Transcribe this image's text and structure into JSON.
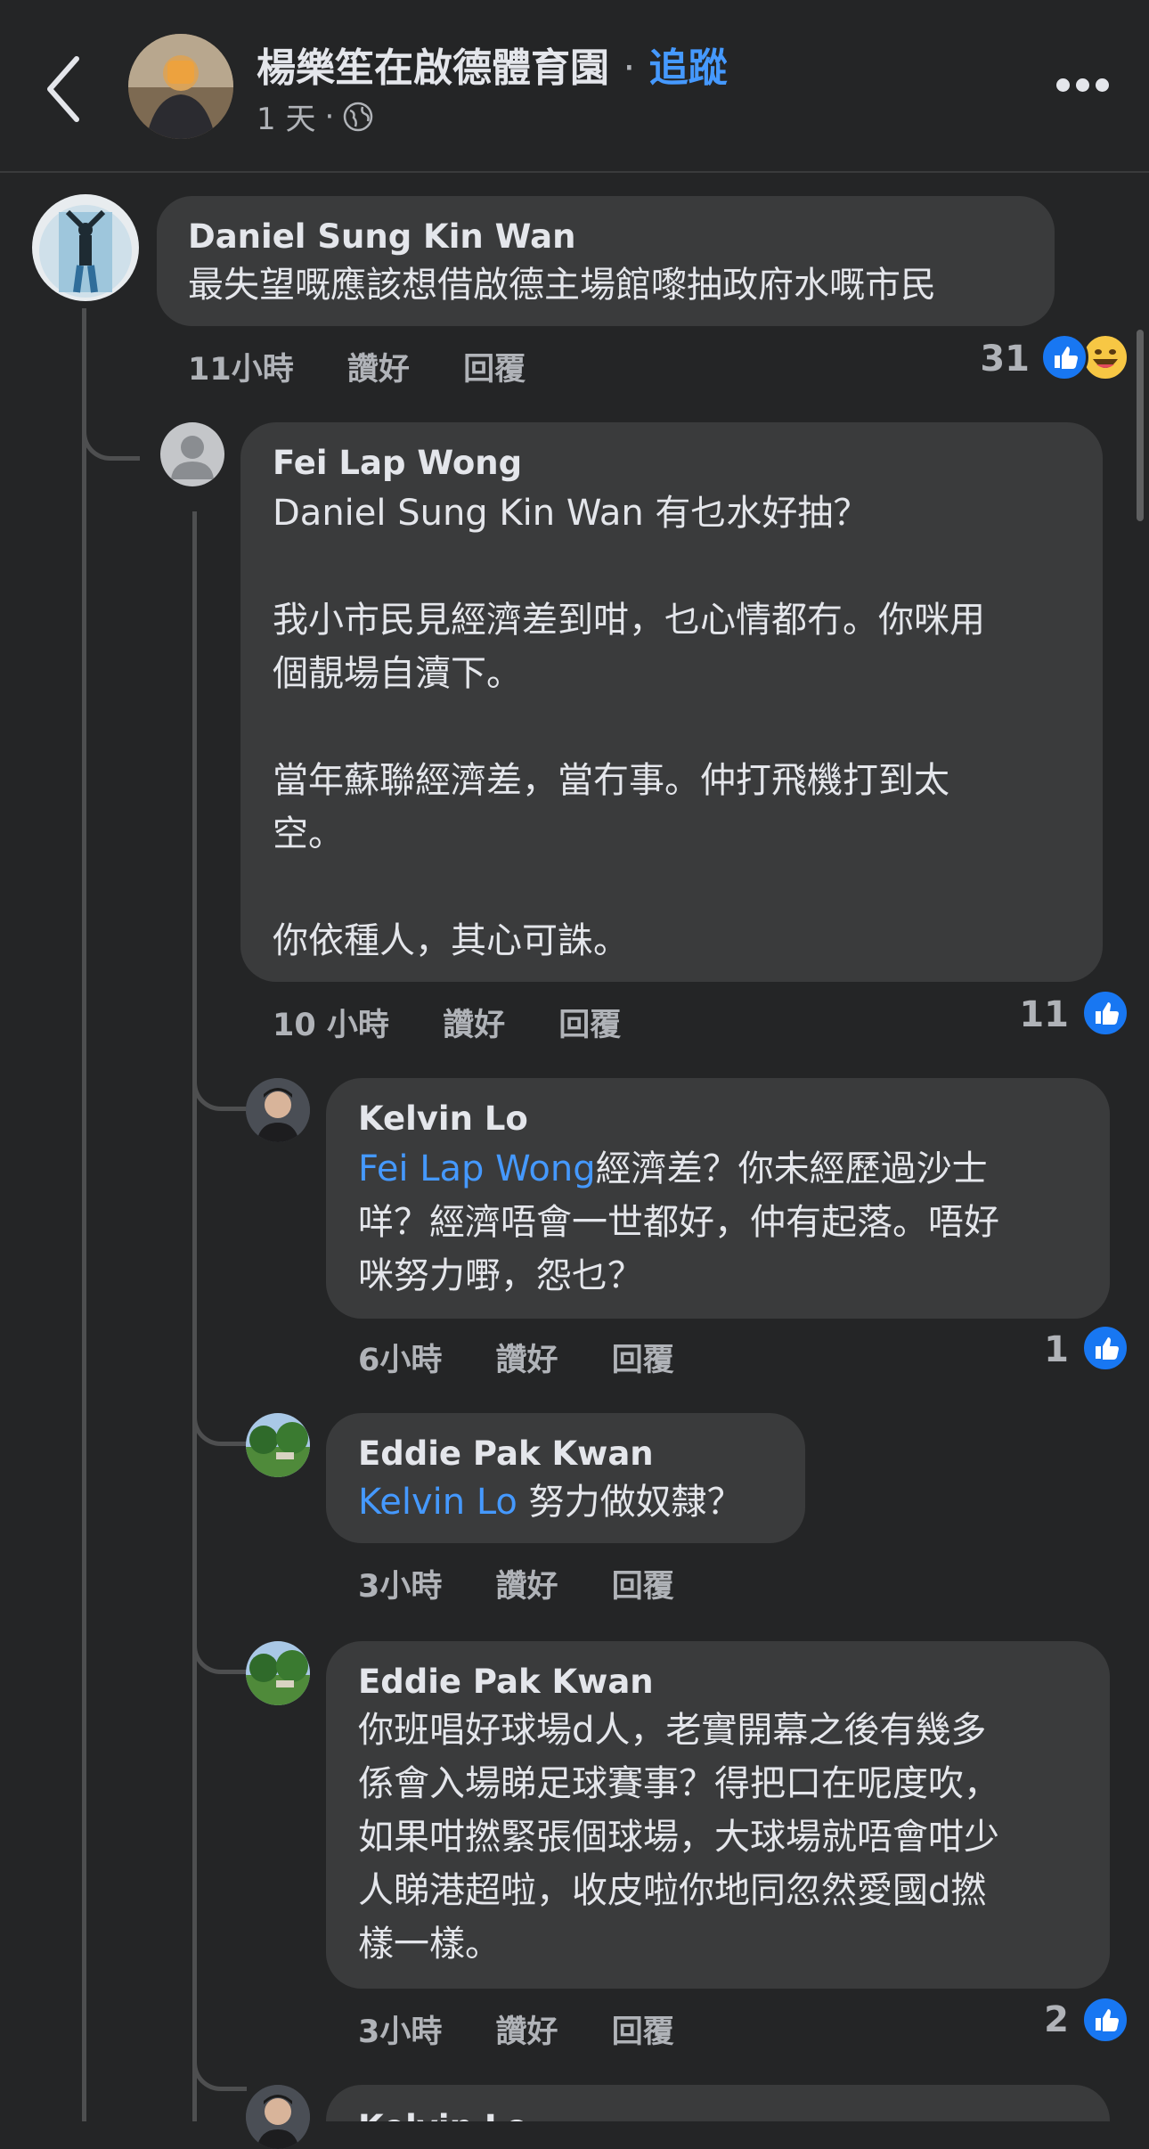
{
  "header": {
    "title": "楊樂笙在啟德體育園",
    "separator": "·",
    "follow_label": "追蹤",
    "time": "1 天",
    "dot": "·"
  },
  "comments": [
    {
      "name": "Daniel Sung Kin Wan",
      "text": "最失望嘅應該想借啟德主場館嚟抽政府水嘅市民",
      "time": "11小時",
      "like_label": "讚好",
      "reply_label": "回覆",
      "reaction_count": "31"
    },
    {
      "name": "Fei Lap Wong",
      "lines": [
        "Daniel Sung Kin Wan 有乜水好抽？",
        "",
        "我小市民見經濟差到咁，乜心情都冇。你咪用",
        "個靚場自瀆下。",
        "",
        "當年蘇聯經濟差，當冇事。仲打飛機打到太",
        "空。",
        "",
        "你依種人，其心可誅。"
      ],
      "time": "10 小時",
      "like_label": "讚好",
      "reply_label": "回覆",
      "reaction_count": "11"
    },
    {
      "name": "Kelvin Lo",
      "mention": "Fei Lap Wong",
      "line1_rest": "經濟差？你未經歷過沙士",
      "line2": "咩？經濟唔會一世都好，仲有起落。唔好",
      "line3": "咪努力嘢，怨乜？",
      "time": "6小時",
      "like_label": "讚好",
      "reply_label": "回覆",
      "reaction_count": "1"
    },
    {
      "name": "Eddie Pak Kwan",
      "mention": "Kelvin Lo",
      "text_rest": " 努力做奴隸？",
      "time": "3小時",
      "like_label": "讚好",
      "reply_label": "回覆"
    },
    {
      "name": "Eddie Pak Kwan",
      "lines": [
        "你班唱好球場d人，老實開幕之後有幾多",
        "係會入場睇足球賽事？得把口在呢度吹，",
        "如果咁撚緊張個球場，大球場就唔會咁少",
        "人睇港超啦，收皮啦你地同忽然愛國d撚",
        "樣一樣。"
      ],
      "time": "3小時",
      "like_label": "讚好",
      "reply_label": "回覆",
      "reaction_count": "2"
    },
    {
      "name": "Kelvin Lo"
    }
  ],
  "icons": {
    "back": "chevron-left-icon",
    "privacy": "globe-icon",
    "more": "more-horizontal-icon",
    "like_reaction": "like-reaction-icon",
    "haha_reaction": "haha-reaction-icon"
  },
  "colors": {
    "background": "#242526",
    "bubble": "#3a3b3c",
    "accent": "#4599ff",
    "like": "#1877f2"
  }
}
